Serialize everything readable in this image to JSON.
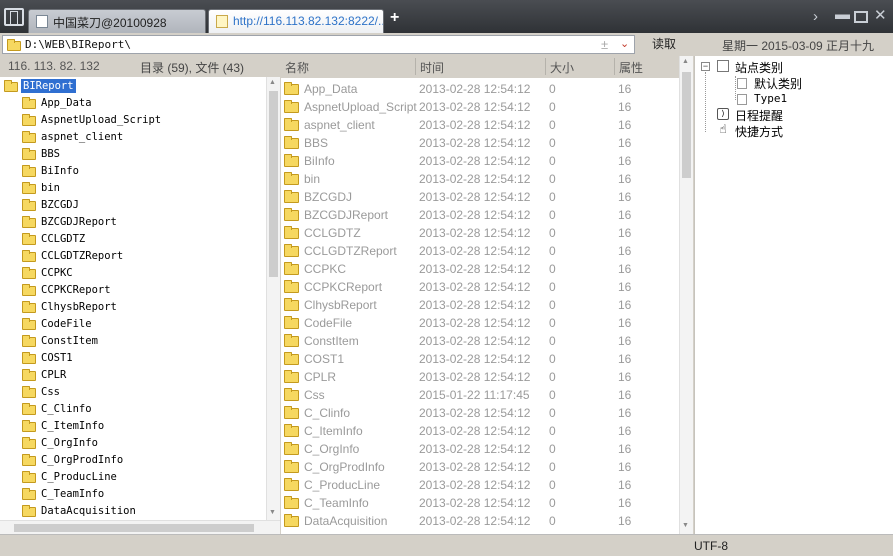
{
  "tabs": [
    {
      "label": "中国菜刀@20100928",
      "active": false
    },
    {
      "label": "http://116.113.82.132:8222/...",
      "active": true
    }
  ],
  "new_tab_label": "+",
  "address": {
    "path": "D:\\WEB\\BIReport\\",
    "read_button": "读取",
    "plus_minus": "±",
    "dropdown": "⌄"
  },
  "date_text": "星期一 2015-03-09 正月十九",
  "left_panel": {
    "ip": "116. 113. 82. 132",
    "counts": "目录 (59), 文件 (43)",
    "root": "BIReport",
    "folders": [
      "App_Data",
      "AspnetUpload_Script",
      "aspnet_client",
      "BBS",
      "BiInfo",
      "bin",
      "BZCGDJ",
      "BZCGDJReport",
      "CCLGDTZ",
      "CCLGDTZReport",
      "CCPKC",
      "CCPKCReport",
      "ClhysbReport",
      "CodeFile",
      "ConstItem",
      "COST1",
      "CPLR",
      "Css",
      "C_Clinfo",
      "C_ItemInfo",
      "C_OrgInfo",
      "C_OrgProdInfo",
      "C_ProducLine",
      "C_TeamInfo",
      "DataAcquisition"
    ]
  },
  "file_list": {
    "columns": {
      "name": "名称",
      "time": "时间",
      "size": "大小",
      "attr": "属性"
    },
    "rows": [
      {
        "name": "App_Data",
        "time": "2013-02-28 12:54:12",
        "size": "0",
        "attr": "16"
      },
      {
        "name": "AspnetUpload_Script",
        "time": "2013-02-28 12:54:12",
        "size": "0",
        "attr": "16"
      },
      {
        "name": "aspnet_client",
        "time": "2013-02-28 12:54:12",
        "size": "0",
        "attr": "16"
      },
      {
        "name": "BBS",
        "time": "2013-02-28 12:54:12",
        "size": "0",
        "attr": "16"
      },
      {
        "name": "BiInfo",
        "time": "2013-02-28 12:54:12",
        "size": "0",
        "attr": "16"
      },
      {
        "name": "bin",
        "time": "2013-02-28 12:54:12",
        "size": "0",
        "attr": "16"
      },
      {
        "name": "BZCGDJ",
        "time": "2013-02-28 12:54:12",
        "size": "0",
        "attr": "16"
      },
      {
        "name": "BZCGDJReport",
        "time": "2013-02-28 12:54:12",
        "size": "0",
        "attr": "16"
      },
      {
        "name": "CCLGDTZ",
        "time": "2013-02-28 12:54:12",
        "size": "0",
        "attr": "16"
      },
      {
        "name": "CCLGDTZReport",
        "time": "2013-02-28 12:54:12",
        "size": "0",
        "attr": "16"
      },
      {
        "name": "CCPKC",
        "time": "2013-02-28 12:54:12",
        "size": "0",
        "attr": "16"
      },
      {
        "name": "CCPKCReport",
        "time": "2013-02-28 12:54:12",
        "size": "0",
        "attr": "16"
      },
      {
        "name": "ClhysbReport",
        "time": "2013-02-28 12:54:12",
        "size": "0",
        "attr": "16"
      },
      {
        "name": "CodeFile",
        "time": "2013-02-28 12:54:12",
        "size": "0",
        "attr": "16"
      },
      {
        "name": "ConstItem",
        "time": "2013-02-28 12:54:12",
        "size": "0",
        "attr": "16"
      },
      {
        "name": "COST1",
        "time": "2013-02-28 12:54:12",
        "size": "0",
        "attr": "16"
      },
      {
        "name": "CPLR",
        "time": "2013-02-28 12:54:12",
        "size": "0",
        "attr": "16"
      },
      {
        "name": "Css",
        "time": "2015-01-22 11:17:45",
        "size": "0",
        "attr": "16"
      },
      {
        "name": "C_Clinfo",
        "time": "2013-02-28 12:54:12",
        "size": "0",
        "attr": "16"
      },
      {
        "name": "C_ItemInfo",
        "time": "2013-02-28 12:54:12",
        "size": "0",
        "attr": "16"
      },
      {
        "name": "C_OrgInfo",
        "time": "2013-02-28 12:54:12",
        "size": "0",
        "attr": "16"
      },
      {
        "name": "C_OrgProdInfo",
        "time": "2013-02-28 12:54:12",
        "size": "0",
        "attr": "16"
      },
      {
        "name": "C_ProducLine",
        "time": "2013-02-28 12:54:12",
        "size": "0",
        "attr": "16"
      },
      {
        "name": "C_TeamInfo",
        "time": "2013-02-28 12:54:12",
        "size": "0",
        "attr": "16"
      },
      {
        "name": "DataAcquisition",
        "time": "2013-02-28 12:54:12",
        "size": "0",
        "attr": "16"
      }
    ]
  },
  "right_panel": {
    "site_category": "站点类别",
    "default_category": "默认类别",
    "type1": "Type1",
    "schedule": "日程提醒",
    "shortcut": "快捷方式"
  },
  "status": {
    "encoding": "UTF-8"
  },
  "colors": {
    "selection": "#2f6fd1",
    "folder": "#f6d860",
    "active_tab_text": "#2e73c8",
    "chrome": "#d4d0c8"
  },
  "icons": [
    "app-menu-icon",
    "document-icon",
    "folder-icon",
    "chevron-right-icon",
    "minimize-icon",
    "maximize-icon",
    "close-icon",
    "calendar-icon",
    "shortcut-icon"
  ]
}
